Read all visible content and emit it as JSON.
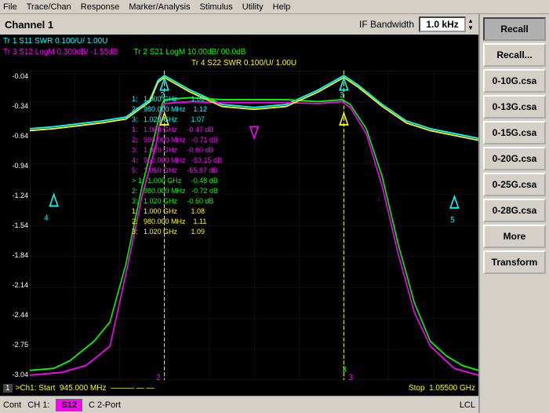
{
  "menubar": {
    "items": [
      "File",
      "Trace/Chan",
      "Response",
      "Marker/Analysis",
      "Stimulus",
      "Utility",
      "Help"
    ]
  },
  "header": {
    "channel": "Channel 1",
    "if_bandwidth_label": "IF Bandwidth",
    "if_bandwidth_value": "1.0 kHz"
  },
  "traces": {
    "tr1": "Tr 1  S11 SWR 0.100/U/  1.00U",
    "tr2": "Tr 2  S21 LogM 10.00dB/  00.0dB",
    "tr3": "Tr 3  S12 LogM 0.300dB/  -1.55dB",
    "tr4": "Tr 4  S22 SWR 0.100/U/  1.00U"
  },
  "y_axis": {
    "labels": [
      "-0.04",
      "-0.34",
      "-0.64",
      "-0.94",
      "-1.24",
      "-1.54",
      "-1.84",
      "-2.14",
      "-2.44",
      "-2.75",
      "-3.04"
    ]
  },
  "marker_data": {
    "lines": [
      {
        "color": "cyan",
        "text": "1:   1.000 GHz       1.09"
      },
      {
        "color": "cyan",
        "text": "2:   980.000 MHz      1.12"
      },
      {
        "color": "cyan",
        "text": "3:   1.020 GHz        1.07"
      },
      {
        "color": "magenta",
        "text": "1:   1.000 GHz      -0.47 dB"
      },
      {
        "color": "magenta",
        "text": "2:   980.000 MHz     -0.71 dB"
      },
      {
        "color": "magenta",
        "text": "3:   1.020 GHz       -0.60 dB"
      },
      {
        "color": "magenta",
        "text": "4:   950.000 MHz     -53.15 dB"
      },
      {
        "color": "magenta",
        "text": "5:   1.050 GHz       -55.87 dB"
      },
      {
        "color": "green",
        "text": "> 1:   1.000 GHz     -0.48 dB"
      },
      {
        "color": "green",
        "text": "2:   980.000 MHz     -0.72 dB"
      },
      {
        "color": "green",
        "text": "3:   1.020 GHz       -0.60 dB"
      },
      {
        "color": "yellow",
        "text": "1:   1.000 GHz       1.08"
      },
      {
        "color": "yellow",
        "text": "2:   980.000 MHz      1.11"
      },
      {
        "color": "yellow",
        "text": "3:   1.020 GHz        1.09"
      }
    ]
  },
  "bottom_bar": {
    "seg_num": "1",
    "start": ">Ch1: Start  945.000 MHz  ———  — —",
    "stop": "Stop  1.05500 GHz"
  },
  "status_bar": {
    "cont": "Cont",
    "ch": "CH 1:",
    "trace": "S12",
    "port": "C  2-Port",
    "lcl": "LCL"
  },
  "sidebar": {
    "buttons": [
      "Recall",
      "Recall...",
      "0-10G.csa",
      "0-13G.csa",
      "0-15G.csa",
      "0-20G.csa",
      "0-25G.csa",
      "0-28G.csa",
      "More",
      "Transform"
    ]
  }
}
